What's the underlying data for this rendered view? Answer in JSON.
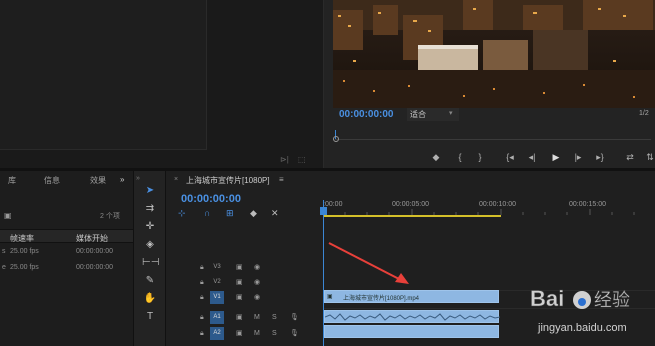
{
  "source": {
    "footer_icons": [
      "export-frame-icon",
      "settings-icon"
    ]
  },
  "program": {
    "timecode": "00:00:00:00",
    "fit_label": "适合",
    "page": "1/2",
    "controls": [
      "marker-icon",
      "in-point-icon",
      "out-point-icon",
      "go-to-in-icon",
      "step-back-icon",
      "play-icon",
      "step-forward-icon",
      "go-to-out-icon",
      "insert-icon",
      "overwrite-icon"
    ]
  },
  "project": {
    "tabs": [
      "库",
      "信息",
      "效果"
    ],
    "more": "»",
    "item_count": "2 个项",
    "columns": [
      "帧速率",
      "媒体开始"
    ],
    "rows": [
      {
        "fps": "25.00 fps",
        "start": "00:00:00:00"
      },
      {
        "fps": "25.00 fps",
        "start": "00:00:00:00"
      }
    ]
  },
  "timeline": {
    "title": "上海城市宣传片[1080P]",
    "menu_icon": "≡",
    "timecode": "00:00:00:00",
    "ruler_labels": [
      ":00:00",
      "00:00:05:00",
      "00:00:10:00",
      "00:00:15:00"
    ],
    "tracks": [
      {
        "label": "V3",
        "active": false,
        "type": "video"
      },
      {
        "label": "V2",
        "active": false,
        "type": "video"
      },
      {
        "label": "V1",
        "active": true,
        "type": "video"
      },
      {
        "label": "A1",
        "active": true,
        "type": "audio"
      },
      {
        "label": "A2",
        "active": true,
        "type": "audio"
      }
    ],
    "clip_name": "上海城市宣传片[1080P].mp4"
  },
  "watermark": {
    "brand": "Baidu 经验",
    "url": "jingyan.baidu.com"
  }
}
